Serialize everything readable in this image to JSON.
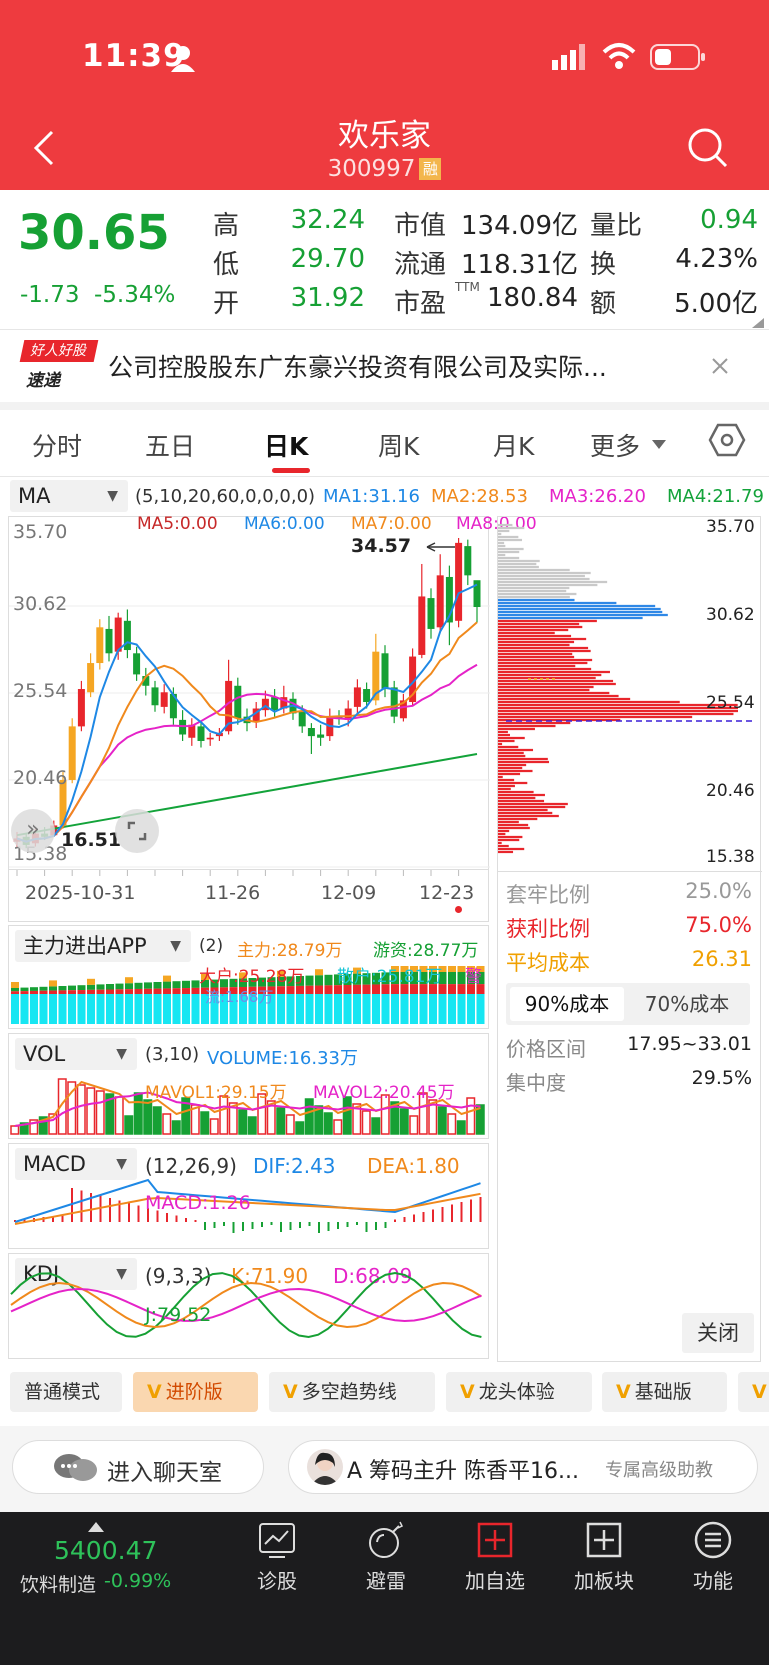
{
  "status_bar": {
    "time": "11:39"
  },
  "header": {
    "title": "欢乐家",
    "code": "300997",
    "rong": "融"
  },
  "quote": {
    "price": "30.65",
    "change": "-1.73",
    "change_pct": "-5.34%",
    "high_label": "高",
    "high": "32.24",
    "low_label": "低",
    "low": "29.70",
    "open_label": "开",
    "open": "31.92",
    "mktcap_label": "市值",
    "mktcap": "134.09亿",
    "float_label": "流通",
    "float": "118.31亿",
    "pe_label": "市盈",
    "pe_tag": "TTM",
    "pe": "180.84",
    "volratio_label": "量比",
    "volratio": "0.94",
    "turnover_label": "换",
    "turnover": "4.23%",
    "amount_label": "额",
    "amount": "5.00亿"
  },
  "news": {
    "logo_top": "好人好股",
    "logo_bottom": "速递",
    "text": "公司控股股东广东豪兴投资有限公司及实际..."
  },
  "tabs": [
    "分时",
    "五日",
    "日K",
    "周K",
    "月K",
    "更多"
  ],
  "ma_bar": {
    "select": "MA",
    "params": "(5,10,20,60,0,0,0,0)",
    "ma1": "MA1:31.16",
    "ma2": "MA2:28.53",
    "ma3": "MA3:26.20",
    "ma4": "MA4:21.79",
    "ma5": "MA5:0.00",
    "ma6": "MA6:0.00",
    "ma7": "MA7:0.00",
    "ma8": "MA8:0.00"
  },
  "kline": {
    "y_labels": [
      "35.70",
      "30.62",
      "25.54",
      "20.46",
      "15.38"
    ],
    "max_label": "34.57",
    "min_label": "16.51",
    "x_labels": [
      "2025-10-31",
      "11-26",
      "12-09",
      "12-23"
    ]
  },
  "chip_panel": {
    "y_labels": [
      "35.70",
      "30.62",
      "25.54",
      "20.46",
      "15.38"
    ],
    "rows": [
      {
        "k": "套牢比例",
        "v": "25.0%"
      },
      {
        "k": "获利比例",
        "v": "75.0%"
      },
      {
        "k": "平均成本",
        "v": "26.31"
      }
    ],
    "tab1": "90%成本",
    "tab2": "70%成本",
    "range_label": "价格区间",
    "range": "17.95~33.01",
    "conc_label": "集中度",
    "conc": "29.5%",
    "close": "关闭"
  },
  "indicator1": {
    "select": "主力进出APP",
    "params": "(2)",
    "main": "主力:28.79万",
    "youzi": "游资:28.77万",
    "dahu": "大户:25.28万",
    "sanhu": "散户:25.81万",
    "warn": "警",
    "hidden": "流:1.68万"
  },
  "vol": {
    "select": "VOL",
    "params": "(3,10)",
    "volume": "VOLUME:16.33万",
    "mavol1": "MAVOL1:29.15万",
    "mavol2": "MAVOL2:20.45万"
  },
  "macd": {
    "select": "MACD",
    "params": "(12,26,9)",
    "dif": "DIF:2.43",
    "dea": "DEA:1.80",
    "macd": "MACD:1.26"
  },
  "kdj": {
    "select": "KDJ",
    "params": "(9,3,3)",
    "k": "K:71.90",
    "d": "D:68.09",
    "j": "J:79.52"
  },
  "modes": [
    "普通模式",
    "进阶版",
    "多空趋势线",
    "龙头体验",
    "基础版"
  ],
  "chat": {
    "enter": "进入聊天室",
    "ad_text": "A 筹码主升 陈香平16...",
    "ad_tag": "专属高级助教"
  },
  "bottom_nav": {
    "index_value": "5400.47",
    "index_name": "饮料制造",
    "index_change": "-0.99%",
    "items": [
      "诊股",
      "避雷",
      "加自选",
      "加板块",
      "功能"
    ]
  }
}
